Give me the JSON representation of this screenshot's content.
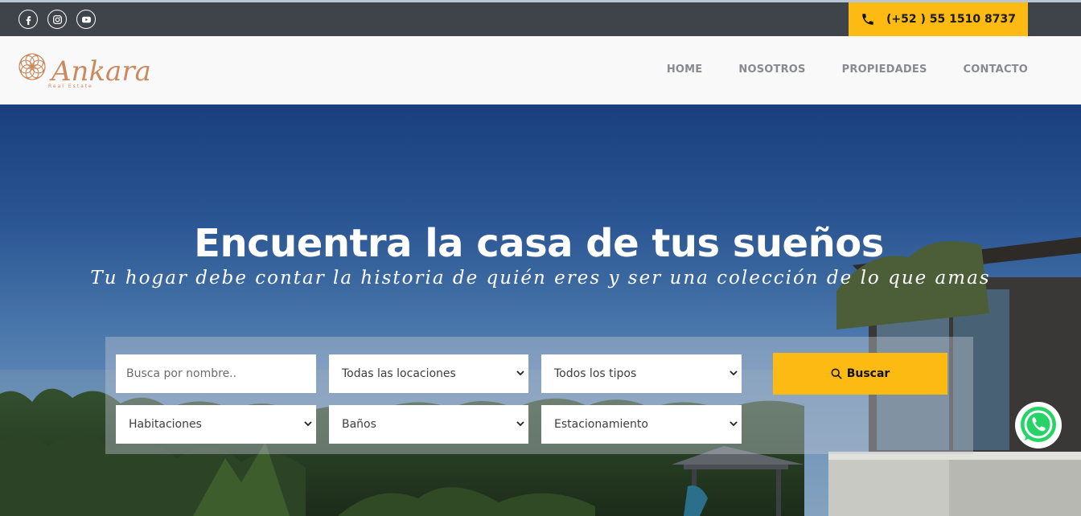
{
  "topbar": {
    "social": [
      "facebook-icon",
      "instagram-icon",
      "youtube-icon"
    ],
    "phone": "(+52 ) 55 1510 8737"
  },
  "brand": {
    "name": "Ankara",
    "tagline": "Real Estate"
  },
  "nav": {
    "items": [
      "HOME",
      "NOSOTROS",
      "PROPIEDADES",
      "CONTACTO"
    ]
  },
  "hero": {
    "title": "Encuentra la casa de tus sueños",
    "subtitle": "Tu hogar debe contar la historia de quién eres y ser una colección de lo que amas"
  },
  "search": {
    "name_placeholder": "Busca por nombre..",
    "location": "Todas las locaciones",
    "type": "Todos los tipos",
    "rooms": "Habitaciones",
    "baths": "Baños",
    "parking": "Estacionamiento",
    "button": "Buscar"
  },
  "colors": {
    "accent": "#fdba12",
    "topbar": "#3f434a",
    "brand": "#c98a5f"
  }
}
